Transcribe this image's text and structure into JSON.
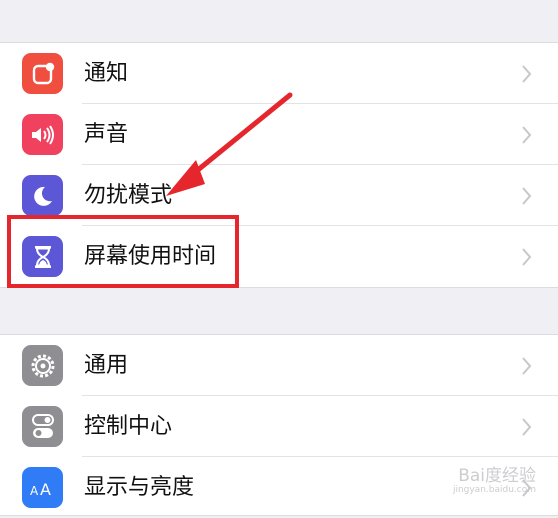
{
  "settings_group_1": [
    {
      "label": "通知",
      "icon": "notifications-icon",
      "color": "#f04e3e"
    },
    {
      "label": "声音",
      "icon": "sounds-icon",
      "color": "#f0415e"
    },
    {
      "label": "勿扰模式",
      "icon": "do-not-disturb-moon-icon",
      "color": "#5b57d6"
    },
    {
      "label": "屏幕使用时间",
      "icon": "screen-time-hourglass-icon",
      "color": "#5b57d6"
    }
  ],
  "settings_group_2": [
    {
      "label": "通用",
      "icon": "general-gear-icon",
      "color": "#8e8e93"
    },
    {
      "label": "控制中心",
      "icon": "control-center-icon",
      "color": "#8e8e93"
    },
    {
      "label": "显示与亮度",
      "icon": "display-brightness-icon",
      "color": "#2f7cf6"
    }
  ],
  "annotation": {
    "highlight_color": "#e5262d"
  },
  "watermark": {
    "text": "Bai度经验",
    "sub": "jingyan.baidu.com"
  }
}
